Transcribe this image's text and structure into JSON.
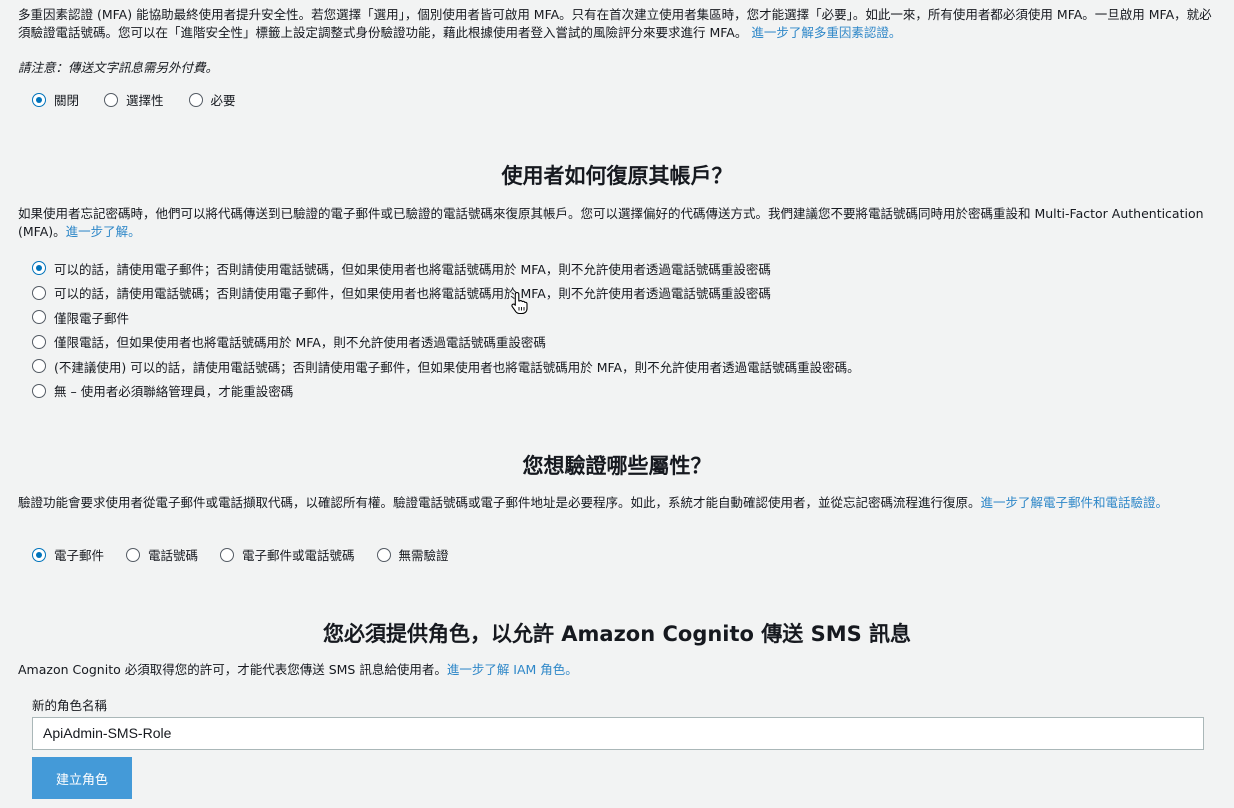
{
  "mfa": {
    "description": "多重因素認證 (MFA) 能協助最終使用者提升安全性。若您選擇「選用」，個別使用者皆可啟用 MFA。只有在首次建立使用者集區時，您才能選擇「必要」。如此一來，所有使用者都必須使用 MFA。一旦啟用 MFA，就必須驗證電話號碼。您可以在「進階安全性」標籤上設定調整式身份驗證功能，藉此根據使用者登入嘗試的風險評分來要求進行 MFA。",
    "learn_more": "進一步了解多重因素認證。",
    "note": "請注意：傳送文字訊息需另外付費。",
    "options": [
      "關閉",
      "選擇性",
      "必要"
    ],
    "selected": "關閉"
  },
  "recovery": {
    "heading": "使用者如何復原其帳戶？",
    "description": "如果使用者忘記密碼時，他們可以將代碼傳送到已驗證的電子郵件或已驗證的電話號碼來復原其帳戶。您可以選擇偏好的代碼傳送方式。我們建議您不要將電話號碼同時用於密碼重設和 Multi-Factor Authentication (MFA)。",
    "learn_more": "進一步了解。",
    "options": [
      "可以的話，請使用電子郵件；否則請使用電話號碼，但如果使用者也將電話號碼用於 MFA，則不允許使用者透過電話號碼重設密碼",
      "可以的話，請使用電話號碼；否則請使用電子郵件，但如果使用者也將電話號碼用於 MFA，則不允許使用者透過電話號碼重設密碼",
      "僅限電子郵件",
      "僅限電話，但如果使用者也將電話號碼用於 MFA，則不允許使用者透過電話號碼重設密碼",
      "(不建議使用) 可以的話，請使用電話號碼；否則請使用電子郵件，但如果使用者也將電話號碼用於 MFA，則不允許使用者透過電話號碼重設密碼。",
      "無 – 使用者必須聯絡管理員，才能重設密碼"
    ],
    "selected_index": 0
  },
  "verify": {
    "heading": "您想驗證哪些屬性？",
    "description": "驗證功能會要求使用者從電子郵件或電話擷取代碼，以確認所有權。驗證電話號碼或電子郵件地址是必要程序。如此，系統才能自動確認使用者，並從忘記密碼流程進行復原。",
    "learn_more": "進一步了解電子郵件和電話驗證。",
    "options": [
      "電子郵件",
      "電話號碼",
      "電子郵件或電話號碼",
      "無需驗證"
    ],
    "selected": "電子郵件"
  },
  "role": {
    "heading": "您必須提供角色，以允許 Amazon Cognito 傳送 SMS 訊息",
    "description": "Amazon Cognito 必須取得您的許可，才能代表您傳送 SMS 訊息給使用者。",
    "learn_more": "進一步了解 IAM 角色。",
    "field_label": "新的角色名稱",
    "field_value": "ApiAdmin-SMS-Role",
    "button_label": "建立角色"
  },
  "colors": {
    "background": "#f2f3f3",
    "link": "#2e87c8",
    "radio_selected": "#0073bb",
    "button": "#449ad8"
  }
}
